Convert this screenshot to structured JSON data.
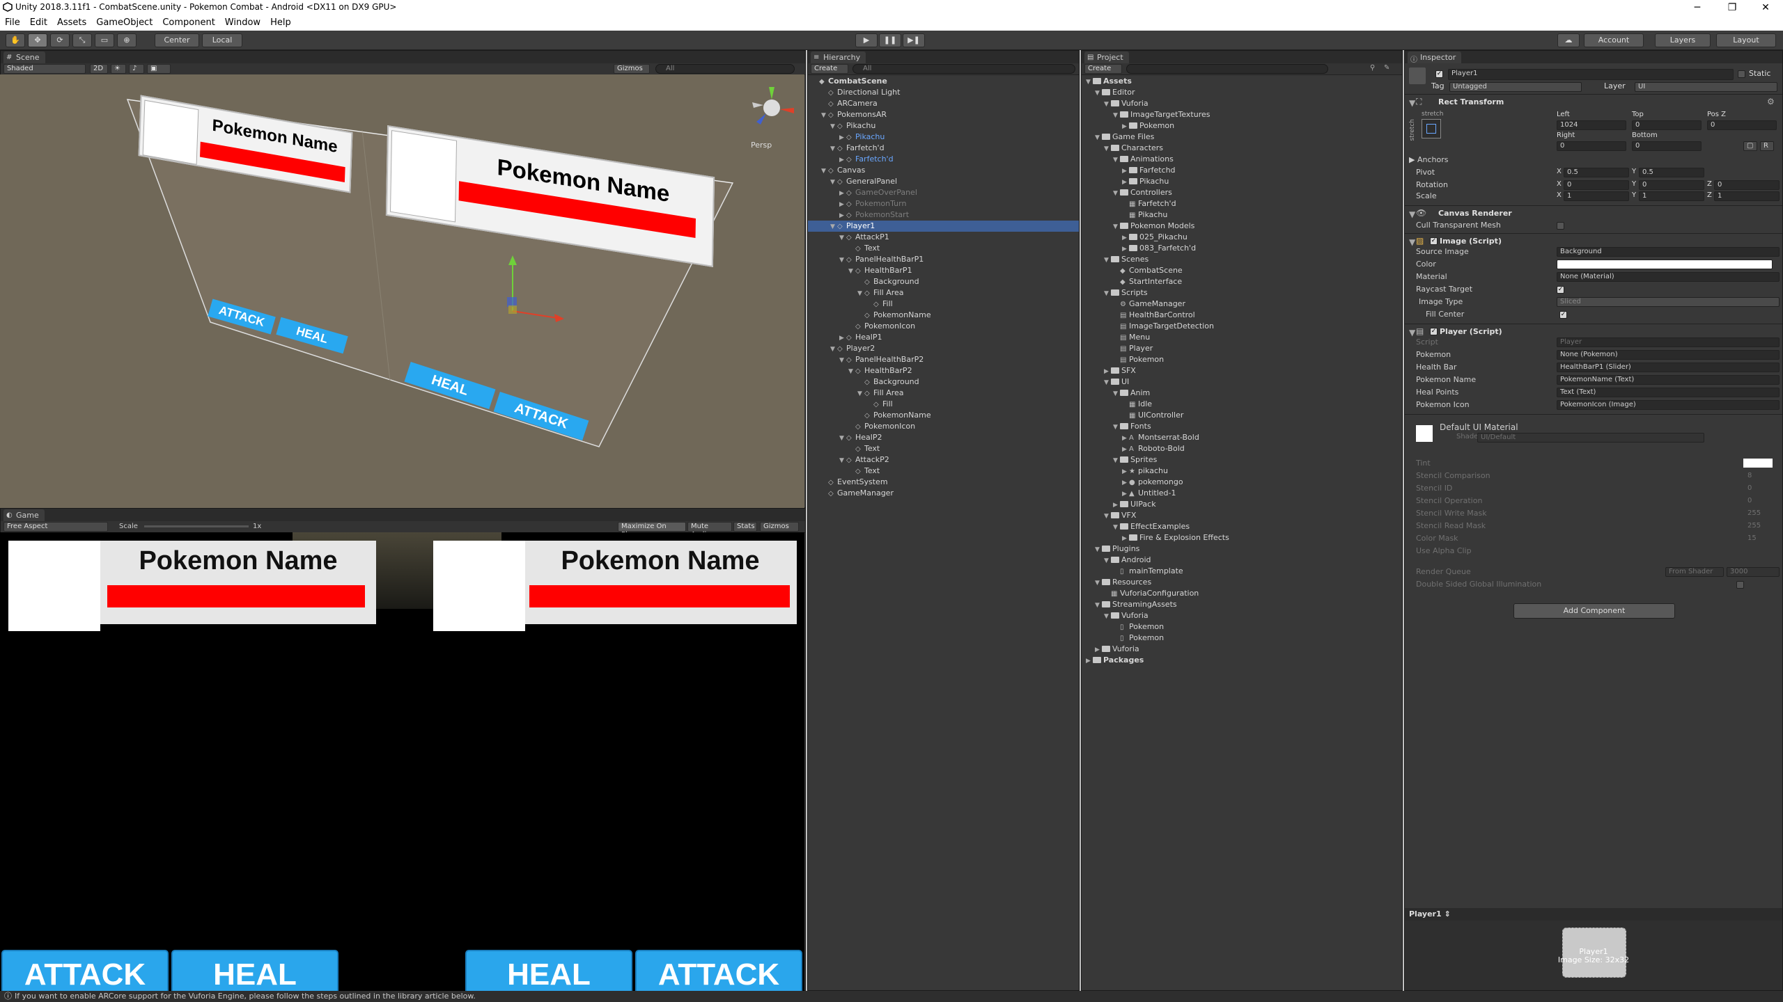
{
  "window": {
    "title": "Unity 2018.3.11f1 - CombatScene.unity - Pokemon Combat - Android <DX11 on DX9 GPU>",
    "minimize": "─",
    "maximize": "❐",
    "close": "✕"
  },
  "menu": [
    "File",
    "Edit",
    "Assets",
    "GameObject",
    "Component",
    "Window",
    "Help"
  ],
  "toolbar": {
    "pivot": "Center",
    "space": "Local",
    "play": "▶",
    "pause": "❚❚",
    "step": "▶❚",
    "account": "Account",
    "layers": "Layers",
    "layout": "Layout"
  },
  "scene": {
    "tab": "Scene",
    "shading": "Shaded",
    "mode2d": "2D",
    "gizmos": "Gizmos",
    "search": "All",
    "persp": "Persp",
    "card_left_name": "Pokemon Name",
    "card_right_name": "Pokemon Name",
    "btn_attack_left": "ATTACK",
    "btn_heal_left": "HEAL",
    "btn_heal_right": "HEAL",
    "btn_attack_right": "ATTACK"
  },
  "game": {
    "tab": "Game",
    "aspect": "Free Aspect",
    "scale_label": "Scale",
    "scale_value": "1x",
    "maximize": "Maximize On Play",
    "mute": "Mute Audio",
    "stats": "Stats",
    "gizmos": "Gizmos",
    "p1_name": "Pokemon Name",
    "p2_name": "Pokemon Name",
    "attack_left": "ATTACK",
    "heal_left": "HEAL",
    "heal_right": "HEAL",
    "attack_right": "ATTACK"
  },
  "hierarchy": {
    "tab": "Hierarchy",
    "create": "Create",
    "search": "All",
    "rows": [
      {
        "t": "CombatScene",
        "d": 0,
        "k": "scene",
        "bold": true
      },
      {
        "t": "Directional Light",
        "d": 1
      },
      {
        "t": "ARCamera",
        "d": 1
      },
      {
        "t": "PokemonsAR",
        "d": 1,
        "a": "▼"
      },
      {
        "t": "Pikachu",
        "d": 2,
        "a": "▼"
      },
      {
        "t": "Pikachu",
        "d": 3,
        "a": "▶",
        "c": "blue"
      },
      {
        "t": "Farfetch'd",
        "d": 2,
        "a": "▼"
      },
      {
        "t": "Farfetch'd",
        "d": 3,
        "a": "▶",
        "c": "blue"
      },
      {
        "t": "Canvas",
        "d": 1,
        "a": "▼"
      },
      {
        "t": "GeneralPanel",
        "d": 2,
        "a": "▼"
      },
      {
        "t": "GameOverPanel",
        "d": 3,
        "a": "▶",
        "c": "dim"
      },
      {
        "t": "PokemonTurn",
        "d": 3,
        "a": "▶",
        "c": "dim"
      },
      {
        "t": "PokemonStart",
        "d": 3,
        "a": "▶",
        "c": "dim"
      },
      {
        "t": "Player1",
        "d": 2,
        "a": "▼",
        "c": "sel"
      },
      {
        "t": "AttackP1",
        "d": 3,
        "a": "▼"
      },
      {
        "t": "Text",
        "d": 4
      },
      {
        "t": "PanelHealthBarP1",
        "d": 3,
        "a": "▼"
      },
      {
        "t": "HealthBarP1",
        "d": 4,
        "a": "▼"
      },
      {
        "t": "Background",
        "d": 5
      },
      {
        "t": "Fill Area",
        "d": 5,
        "a": "▼"
      },
      {
        "t": "Fill",
        "d": 6
      },
      {
        "t": "PokemonName",
        "d": 5
      },
      {
        "t": "PokemonIcon",
        "d": 4
      },
      {
        "t": "HealP1",
        "d": 3,
        "a": "▶"
      },
      {
        "t": "Player2",
        "d": 2,
        "a": "▼"
      },
      {
        "t": "PanelHealthBarP2",
        "d": 3,
        "a": "▼"
      },
      {
        "t": "HealthBarP2",
        "d": 4,
        "a": "▼"
      },
      {
        "t": "Background",
        "d": 5
      },
      {
        "t": "Fill Area",
        "d": 5,
        "a": "▼"
      },
      {
        "t": "Fill",
        "d": 6
      },
      {
        "t": "PokemonName",
        "d": 5
      },
      {
        "t": "PokemonIcon",
        "d": 4
      },
      {
        "t": "HealP2",
        "d": 3,
        "a": "▼"
      },
      {
        "t": "Text",
        "d": 4
      },
      {
        "t": "AttackP2",
        "d": 3,
        "a": "▼"
      },
      {
        "t": "Text",
        "d": 4
      },
      {
        "t": "EventSystem",
        "d": 1
      },
      {
        "t": "GameManager",
        "d": 1
      }
    ]
  },
  "project": {
    "tab": "Project",
    "create": "Create",
    "rows": [
      {
        "t": "Assets",
        "d": 0,
        "a": "▼",
        "bold": true,
        "f": true
      },
      {
        "t": "Editor",
        "d": 1,
        "a": "▼",
        "f": true
      },
      {
        "t": "Vuforia",
        "d": 2,
        "a": "▼",
        "f": true
      },
      {
        "t": "ImageTargetTextures",
        "d": 3,
        "a": "▼",
        "f": true
      },
      {
        "t": "Pokemon",
        "d": 4,
        "a": "▶",
        "f": true
      },
      {
        "t": "Game Files",
        "d": 1,
        "a": "▼",
        "f": true
      },
      {
        "t": "Characters",
        "d": 2,
        "a": "▼",
        "f": true
      },
      {
        "t": "Animations",
        "d": 3,
        "a": "▼",
        "f": true
      },
      {
        "t": "Farfetchd",
        "d": 4,
        "a": "▶",
        "f": true
      },
      {
        "t": "Pikachu",
        "d": 4,
        "a": "▶",
        "f": true
      },
      {
        "t": "Controllers",
        "d": 3,
        "a": "▼",
        "f": true
      },
      {
        "t": "Farfetch'd",
        "d": 4,
        "k": "▦"
      },
      {
        "t": "Pikachu",
        "d": 4,
        "k": "▦"
      },
      {
        "t": "Pokemon Models",
        "d": 3,
        "a": "▼",
        "f": true
      },
      {
        "t": "025_Pikachu",
        "d": 4,
        "a": "▶",
        "f": true
      },
      {
        "t": "083_Farfetch'd",
        "d": 4,
        "a": "▶",
        "f": true
      },
      {
        "t": "Scenes",
        "d": 2,
        "a": "▼",
        "f": true
      },
      {
        "t": "CombatScene",
        "d": 3,
        "k": "◆"
      },
      {
        "t": "StartInterface",
        "d": 3,
        "k": "◆"
      },
      {
        "t": "Scripts",
        "d": 2,
        "a": "▼",
        "f": true
      },
      {
        "t": "GameManager",
        "d": 3,
        "k": "⚙"
      },
      {
        "t": "HealthBarControl",
        "d": 3,
        "k": "▤"
      },
      {
        "t": "ImageTargetDetection",
        "d": 3,
        "k": "▤"
      },
      {
        "t": "Menu",
        "d": 3,
        "k": "▤"
      },
      {
        "t": "Player",
        "d": 3,
        "k": "▤"
      },
      {
        "t": "Pokemon",
        "d": 3,
        "k": "▤"
      },
      {
        "t": "SFX",
        "d": 2,
        "a": "▶",
        "f": true
      },
      {
        "t": "UI",
        "d": 2,
        "a": "▼",
        "f": true
      },
      {
        "t": "Anim",
        "d": 3,
        "a": "▼",
        "f": true
      },
      {
        "t": "Idle",
        "d": 4,
        "k": "▦"
      },
      {
        "t": "UIController",
        "d": 4,
        "k": "▦"
      },
      {
        "t": "Fonts",
        "d": 3,
        "a": "▼",
        "f": true
      },
      {
        "t": "Montserrat-Bold",
        "d": 4,
        "a": "▶",
        "k": "A"
      },
      {
        "t": "Roboto-Bold",
        "d": 4,
        "a": "▶",
        "k": "A"
      },
      {
        "t": "Sprites",
        "d": 3,
        "a": "▼",
        "f": true
      },
      {
        "t": "pikachu",
        "d": 4,
        "a": "▶",
        "k": "★"
      },
      {
        "t": "pokemongo",
        "d": 4,
        "a": "▶",
        "k": "●"
      },
      {
        "t": "Untitled-1",
        "d": 4,
        "a": "▶",
        "k": "▲"
      },
      {
        "t": "UIPack",
        "d": 3,
        "a": "▶",
        "f": true
      },
      {
        "t": "VFX",
        "d": 2,
        "a": "▼",
        "f": true
      },
      {
        "t": "EffectExamples",
        "d": 3,
        "a": "▼",
        "f": true
      },
      {
        "t": "Fire & Explosion Effects",
        "d": 4,
        "a": "▶",
        "f": true
      },
      {
        "t": "Plugins",
        "d": 1,
        "a": "▼",
        "f": true
      },
      {
        "t": "Android",
        "d": 2,
        "a": "▼",
        "f": true
      },
      {
        "t": "mainTemplate",
        "d": 3,
        "k": "▯"
      },
      {
        "t": "Resources",
        "d": 1,
        "a": "▼",
        "f": true
      },
      {
        "t": "VuforiaConfiguration",
        "d": 2,
        "k": "▦"
      },
      {
        "t": "StreamingAssets",
        "d": 1,
        "a": "▼",
        "f": true
      },
      {
        "t": "Vuforia",
        "d": 2,
        "a": "▼",
        "f": true
      },
      {
        "t": "Pokemon",
        "d": 3,
        "k": "▯"
      },
      {
        "t": "Pokemon",
        "d": 3,
        "k": "▯"
      },
      {
        "t": "Vuforia",
        "d": 1,
        "a": "▶",
        "f": true
      },
      {
        "t": "Packages",
        "d": 0,
        "a": "▶",
        "bold": true,
        "f": true
      }
    ]
  },
  "inspector": {
    "tab": "Inspector",
    "object_name": "Player1",
    "static": "Static",
    "tag_label": "Tag",
    "tag": "Untagged",
    "layer_label": "Layer",
    "layer": "UI",
    "rect": {
      "title": "Rect Transform",
      "stretch": "stretch",
      "left_l": "Left",
      "top_l": "Top",
      "posz_l": "Pos Z",
      "left": "1024",
      "top": "0",
      "posz": "0",
      "right_l": "Right",
      "bottom_l": "Bottom",
      "right": "0",
      "bottom": "0",
      "anchors": "Anchors",
      "pivot": "Pivot",
      "px": "0.5",
      "py": "0.5",
      "rotation": "Rotation",
      "rx": "0",
      "ry": "0",
      "rz": "0",
      "scale": "Scale",
      "sx": "1",
      "sy": "1",
      "sz": "1",
      "X": "X",
      "Y": "Y",
      "Z": "Z",
      "R": "R"
    },
    "canvas_renderer": {
      "title": "Canvas Renderer",
      "cull": "Cull Transparent Mesh"
    },
    "image": {
      "title": "Image (Script)",
      "source_l": "Source Image",
      "source": "Background",
      "color_l": "Color",
      "material_l": "Material",
      "material": "None (Material)",
      "raycast_l": "Raycast Target",
      "type_l": "Image Type",
      "type": "Sliced",
      "fill_l": "Fill Center"
    },
    "player": {
      "title": "Player (Script)",
      "script_l": "Script",
      "script": "Player",
      "pokemon_l": "Pokemon",
      "pokemon": "None (Pokemon)",
      "health_l": "Health Bar",
      "health": "HealthBarP1 (Slider)",
      "name_l": "Pokemon Name",
      "name": "PokemonName (Text)",
      "heal_l": "Heal Points",
      "heal": "Text (Text)",
      "icon_l": "Pokemon Icon",
      "icon": "PokemonIcon (Image)"
    },
    "material": {
      "title": "Default UI Material",
      "shader_l": "Shader",
      "shader": "UI/Default",
      "props": [
        [
          "Tint",
          ""
        ],
        [
          "Stencil Comparison",
          "8"
        ],
        [
          "Stencil ID",
          "0"
        ],
        [
          "Stencil Operation",
          "0"
        ],
        [
          "Stencil Write Mask",
          "255"
        ],
        [
          "Stencil Read Mask",
          "255"
        ],
        [
          "Color Mask",
          "15"
        ],
        [
          "Use Alpha Clip",
          ""
        ]
      ],
      "queue_l": "Render Queue",
      "queue_mode": "From Shader",
      "queue": "3000",
      "dsgi": "Double Sided Global Illumination"
    },
    "add_component": "Add Component",
    "preview": {
      "title": "Player1",
      "label": "Player1",
      "size": "Image Size: 32x32"
    }
  },
  "status": "If you want to enable ARCore support for the Vuforia Engine, please follow the steps outlined in the library article below."
}
